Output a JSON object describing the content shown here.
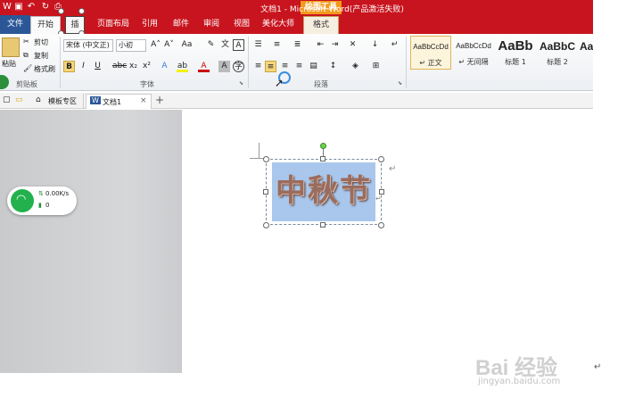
{
  "window": {
    "title": "文档1 - Microsoft Word(产品激活失败)",
    "context_tool_label": "绘图工具"
  },
  "tabs": {
    "file": "文件",
    "home": "开始",
    "insert": "插",
    "layout": "页面布局",
    "references": "引用",
    "mailings": "邮件",
    "review": "审阅",
    "view": "视图",
    "beautify": "美化大师",
    "format": "格式"
  },
  "clipboard": {
    "paste": "粘贴",
    "cut": "剪切",
    "copy": "复制",
    "format_painter": "格式刷",
    "group_label": "剪贴板"
  },
  "font": {
    "font_name": "宋体 (中文正)",
    "font_size": "小初",
    "group_label": "字体"
  },
  "paragraph": {
    "group_label": "段落"
  },
  "styles": {
    "items": [
      {
        "preview": "AaBbCcDd",
        "name": "↵ 正文"
      },
      {
        "preview": "AaBbCcDd",
        "name": "↵ 无间隔"
      },
      {
        "preview": "AaBb",
        "name": "标题 1"
      },
      {
        "preview": "AaBbC",
        "name": "标题 2"
      },
      {
        "preview": "Aa",
        "name": ""
      }
    ]
  },
  "docbar": {
    "template_tab": "模板专区",
    "doc_tab": "文档1"
  },
  "network": {
    "speed": "0.00K/s",
    "count": "0"
  },
  "shape": {
    "wordart_text": "中秋节"
  },
  "watermark": {
    "brand": "Bai 经验",
    "url": "jingyan.baidu.com"
  },
  "colors": {
    "title_bar": "#c8141e",
    "context_tab": "#f39a1c",
    "file_tab": "#2b5797",
    "shape_fill": "#a9c7ec",
    "wordart": "#9b6c5c",
    "wifi": "#22b14c"
  }
}
